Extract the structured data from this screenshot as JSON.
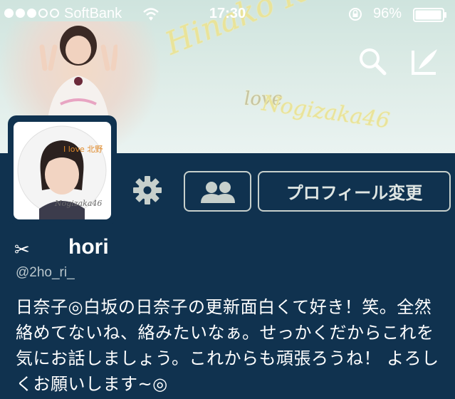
{
  "status_bar": {
    "carrier": "SoftBank",
    "time": "17:30",
    "battery_percent": "96%",
    "signal_bars_filled": 3,
    "signal_bars_total": 5
  },
  "banner": {
    "script_text_1": "Hinako Kitano",
    "script_text_2": "love",
    "script_text_3": "Nogizaka46",
    "icons": [
      "search-icon",
      "compose-icon"
    ]
  },
  "avatar": {
    "caption_top": "I love 北野",
    "caption_bottom": "Nogizaka46"
  },
  "actions": {
    "settings_icon": "gear-icon",
    "people_icon": "people-icon",
    "edit_profile_label": "プロフィール変更"
  },
  "profile": {
    "name_prefix": "✂",
    "name": "hori",
    "handle": "@2ho_ri_",
    "bio": "日奈子◎白坂の日奈子の更新面白くて好き！笑。全然絡めてないね、絡みたいなぁ。せっかくだからこれを気にお話しましょう。これからも頑張ろうね！ よろしくお願いします~◎"
  },
  "colors": {
    "background": "#10324f",
    "button_border": "#c7d0cc",
    "script_yellow": "#e9e39a"
  }
}
